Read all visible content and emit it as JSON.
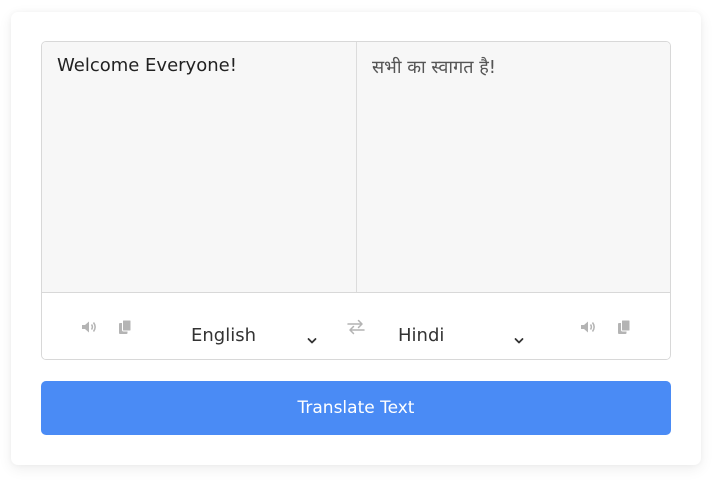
{
  "source": {
    "text": "Welcome Everyone!",
    "language": "English"
  },
  "target": {
    "text": "सभी का स्वागत है!",
    "language": "Hindi"
  },
  "translate_button": {
    "label": "Translate Text"
  },
  "colors": {
    "accent": "#4a8bf5",
    "panel": "#f7f7f7",
    "icon": "#b4b4b4"
  },
  "icons": {
    "speak": "speaker-icon",
    "copy": "copy-icon",
    "swap": "swap-icon",
    "dropdown": "chevron-down-icon"
  }
}
